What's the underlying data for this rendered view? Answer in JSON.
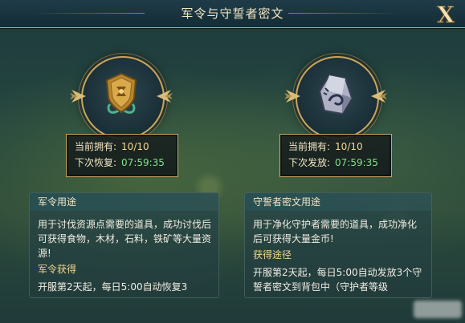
{
  "header": {
    "title": "军令与守誓者密文"
  },
  "close_label": "X",
  "left": {
    "icon": "bronze-shield-token-icon",
    "current_label": "当前拥有:",
    "current_value": "10/10",
    "next_label": "下次恢复:",
    "next_time": "07:59:35",
    "panel": {
      "header": "军令用途",
      "description": "用于讨伐资源点需要的道具，成功讨伐后可获得食物，木材，石料，铁矿等大量资源!",
      "sub_header": "军令获得",
      "sub_text": "开服第2天起，每日5:00自动恢复3"
    }
  },
  "right": {
    "icon": "runestone-cipher-icon",
    "current_label": "当前拥有:",
    "current_value": "10/10",
    "next_label": "下次发放:",
    "next_time": "07:59:35",
    "panel": {
      "header": "守誓者密文用途",
      "description": "用于净化守护者需要的道具，成功净化后可获得大量金币!",
      "sub_header": "获得途径",
      "sub_text": "开服第2天起，每日5:00自动发放3个守誓者密文到背包中（守护者等级"
    }
  },
  "colors": {
    "gold_border": "#c9a65e",
    "timer_green": "#7fe08a",
    "value_gold": "#f5d890"
  }
}
